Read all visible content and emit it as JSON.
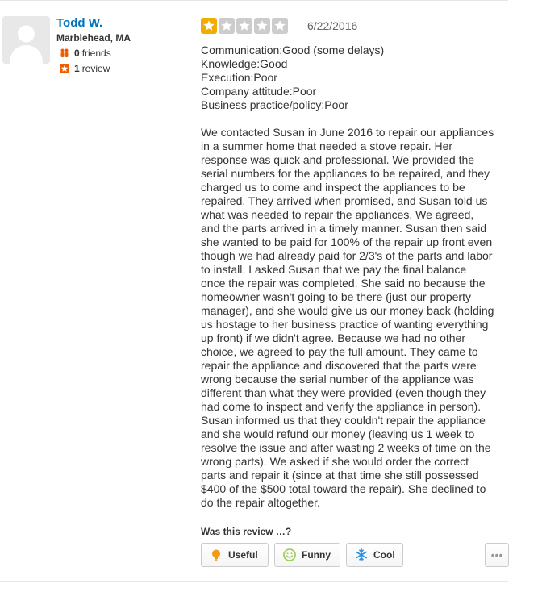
{
  "user": {
    "name": "Todd W.",
    "location": "Marblehead, MA",
    "friends_count": "0",
    "friends_label": "friends",
    "reviews_count": "1",
    "reviews_label": "review"
  },
  "review": {
    "rating": 1,
    "max_rating": 5,
    "date": "6/22/2016",
    "ratings_list": [
      "Communication:Good (some delays)",
      "Knowledge:Good",
      "Execution:Poor",
      "Company attitude:Poor",
      "Business practice/policy:Poor"
    ],
    "body_lines": [
      "We contacted Susan in June 2016 to repair our appliances",
      "in a summer home that needed a stove repair.  Her",
      "response was quick and professional.  We provided the",
      "serial numbers for the appliances to be repaired, and they",
      "charged us to come and inspect the appliances to be",
      "repaired.  They arrived when promised, and Susan told us",
      "what was needed to repair the appliances.  We agreed,",
      "and the parts arrived in a timely manner. Susan then said",
      "she wanted to be paid for 100% of the repair up front even",
      "though we had already paid for 2/3's of the parts and labor",
      "to install.  I asked Susan that we pay the final balance",
      "once the repair was completed.  She said no because the",
      "homeowner wasn't going to be there (just our property",
      "manager), and she would give us our money back (holding",
      "us hostage to her business practice of wanting everything",
      "up front) if we didn't agree.  Because we had no other",
      "choice, we agreed to pay the full amount.  They came to",
      "repair the appliance and discovered that the parts were",
      "wrong because the serial number of the appliance was",
      "different than what they were provided (even though they",
      "had come to inspect and verify the appliance in person).",
      "Susan informed us that they couldn't repair the appliance",
      "and she would refund our money (leaving us 1 week to",
      "resolve the issue and after wasting 2 weeks of time on the",
      "wrong parts). We asked if she would order the correct",
      "parts and repair it (since at that time she still possessed",
      "$400 of the $500 total toward the repair).  She declined to",
      "do the repair altogether."
    ]
  },
  "votes": {
    "prompt": "Was this review …?",
    "useful_label": "Useful",
    "funny_label": "Funny",
    "cool_label": "Cool",
    "more_label": "•••"
  },
  "icons": {
    "avatar": "default-user-avatar",
    "friends": "friends-icon",
    "reviews": "review-star-icon",
    "star": "star-icon",
    "useful": "lightbulb-icon",
    "funny": "smiley-icon",
    "cool": "snowflake-icon",
    "more": "more-icon"
  },
  "colors": {
    "user_link": "#0073bb",
    "star_filled": "#f0ac00",
    "star_empty": "#cccccc",
    "review_badge": "#f15c00",
    "useful_icon": "#f39c12",
    "funny_icon": "#a3cf5e",
    "cool_icon": "#2f8fe0"
  }
}
